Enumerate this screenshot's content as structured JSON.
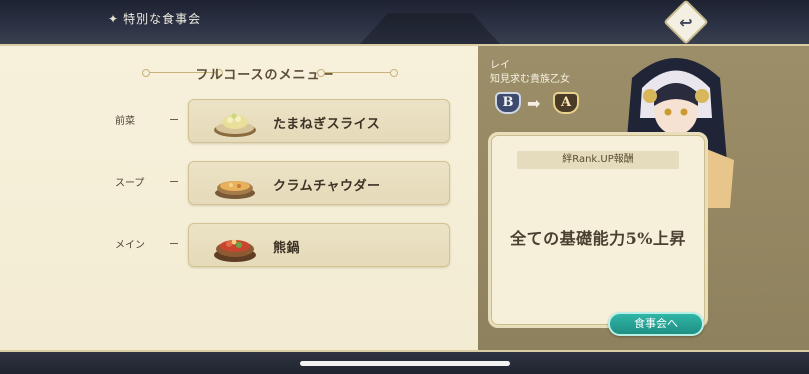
{
  "header": {
    "title": "特別な食事会"
  },
  "menu": {
    "title": "フルコースのメニュー",
    "courses": [
      {
        "course": "前菜",
        "dish": "たまねぎスライス",
        "icon": "onion-salad-icon"
      },
      {
        "course": "スープ",
        "dish": "クラムチャウダー",
        "icon": "soup-bowl-icon"
      },
      {
        "course": "メイン",
        "dish": "熊鍋",
        "icon": "hot-pot-icon"
      }
    ]
  },
  "character": {
    "name": "レイ",
    "title": "知見求む貴族乙女",
    "rank_from": "B",
    "rank_to": "A"
  },
  "reward": {
    "label": "絆Rank.UP報酬",
    "text": "全ての基礎能力5%上昇"
  },
  "actions": {
    "feast_button": "食事会へ"
  },
  "colors": {
    "accent": "#2fb6a6",
    "parchment": "#f7f1dc",
    "panel": "#9c8e68"
  }
}
